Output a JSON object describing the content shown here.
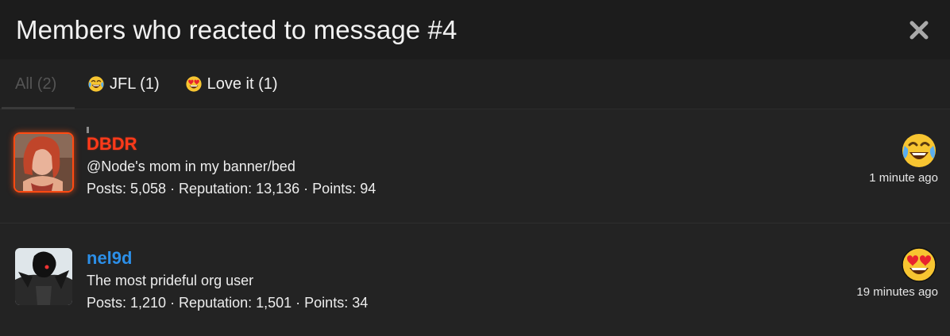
{
  "dialog": {
    "title": "Members who reacted to message #4"
  },
  "tabs": [
    {
      "label": "All (2)",
      "icon": ""
    },
    {
      "label": "JFL (1)",
      "icon": "joy-crying-emoji"
    },
    {
      "label": "Love it (1)",
      "icon": "heart-eyes-emoji"
    }
  ],
  "members": [
    {
      "username": "DBDR",
      "tagline": "@Node's mom in my banner/bed",
      "stats": "Posts: 5,058 · Reputation: 13,136 · Points: 94",
      "reaction": "joy-crying-emoji",
      "time": "1 minute ago",
      "username_color": "#ff3a1a"
    },
    {
      "username": "nel9d",
      "tagline": "The most prideful org user",
      "stats": "Posts: 1,210 · Reputation: 1,501 · Points: 34",
      "reaction": "heart-eyes-emoji",
      "time": "19 minutes ago",
      "username_color": "#2c8fe8"
    }
  ],
  "colors": {
    "background": "#232323",
    "header": "#1c1c1c",
    "accent_red": "#ff3a1a",
    "accent_blue": "#2c8fe8"
  }
}
